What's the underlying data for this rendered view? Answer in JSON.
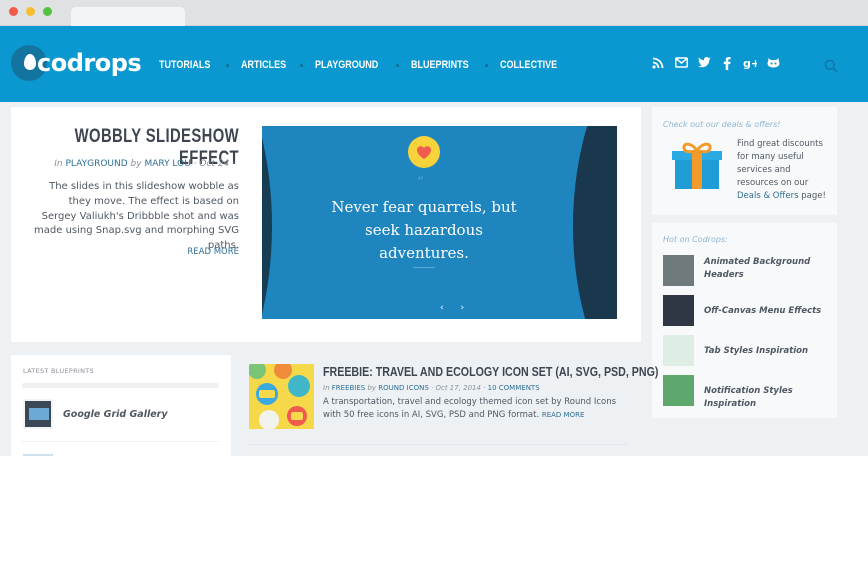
{
  "header": {
    "logo_text": "codrops",
    "nav": [
      "TUTORIALS",
      "ARTICLES",
      "PLAYGROUND",
      "BLUEPRINTS",
      "COLLECTIVE"
    ],
    "social_icons": [
      "rss-icon",
      "mail-icon",
      "twitter-icon",
      "facebook-icon",
      "google-plus-icon",
      "github-icon"
    ],
    "search_icon": "search-icon"
  },
  "feature": {
    "title": "WOBBLY SLIDESHOW EFFECT",
    "meta_in": "In",
    "category": "PLAYGROUND",
    "meta_by": "by",
    "author": "MARY LOU",
    "date": "· Oct 24 ·",
    "description": "The slides in this slideshow wobble as they move. The effect is based on Sergey Valiukh's Dribbble shot and was made using Snap.svg and morphing SVG paths.",
    "read_more": "READ MORE",
    "slide": {
      "quote_mark": "“",
      "quote": "Never fear quarrels, but seek hazardous adventures.",
      "arrows": "‹ ›"
    }
  },
  "deals": {
    "header": "Check out our deals & offers!",
    "text": "Find great discounts for many useful services and resources on our",
    "link": "Deals & Offers",
    "suffix": "page!"
  },
  "hot": {
    "header": "Hot on Codrops:",
    "items": [
      "Animated Background Headers",
      "Off-Canvas Menu Effects",
      "Tab Styles Inspiration",
      "Notification Styles Inspiration"
    ]
  },
  "blueprints": {
    "header": "LATEST BLUEPRINTS",
    "items": [
      "Google Grid Gallery"
    ]
  },
  "post": {
    "title": "FREEBIE: TRAVEL AND ECOLOGY ICON SET (AI, SVG, PSD, PNG)",
    "meta_in": "In",
    "category": "FREEBIES",
    "meta_by": "by",
    "author": "ROUND ICONS",
    "date": "· Oct 17, 2014 ·",
    "comments": "10 COMMENTS",
    "description": "A transportation, travel and ecology themed icon set by Round Icons with 50 free icons in AI, SVG, PSD and PNG format.",
    "read_more": "READ MORE"
  },
  "colors": {
    "header_blue": "#0b97cf",
    "link_blue": "#2e6f94",
    "page_bg": "#eef1f4"
  }
}
